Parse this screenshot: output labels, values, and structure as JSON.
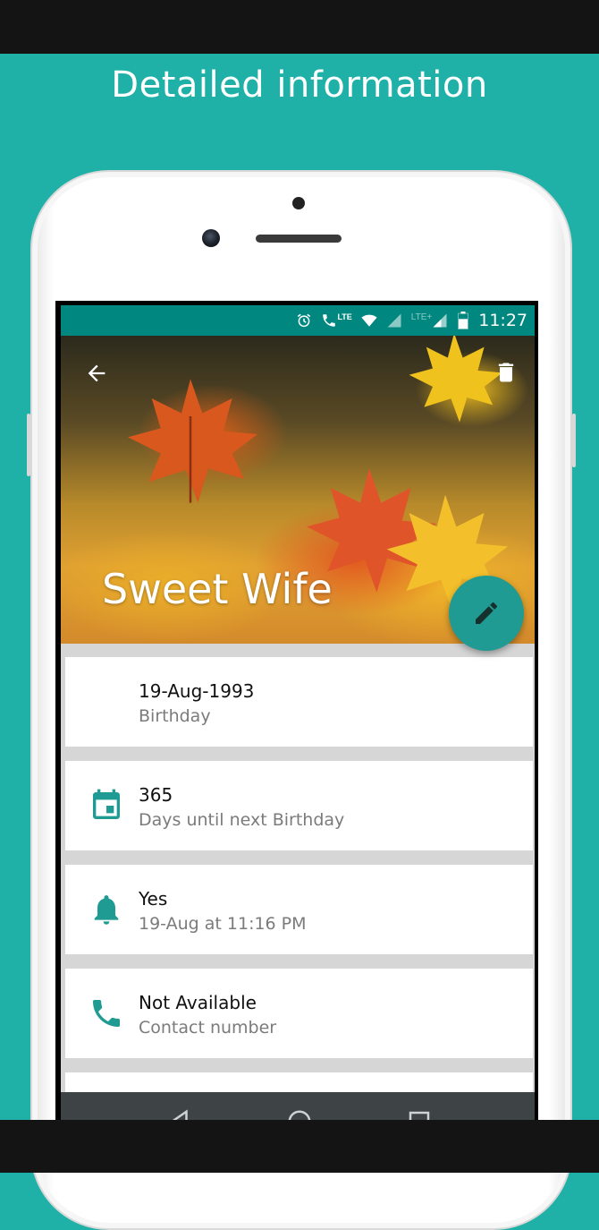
{
  "promo": {
    "title": "Detailed information"
  },
  "status_bar": {
    "time": "11:27",
    "lte_label": "LTE",
    "lte_plus_label": "LTE+"
  },
  "hero": {
    "name": "Sweet Wife"
  },
  "cards": [
    {
      "primary": "19-Aug-1993",
      "secondary": "Birthday",
      "icon": "none"
    },
    {
      "primary": "365",
      "secondary": "Days until next Birthday",
      "icon": "calendar-icon"
    },
    {
      "primary": "Yes",
      "secondary": "19-Aug at 11:16 PM",
      "icon": "bell-icon"
    },
    {
      "primary": "Not Available",
      "secondary": "Contact number",
      "icon": "phone-icon"
    }
  ],
  "colors": {
    "accent": "#1f9b93",
    "status_bar": "#00877f",
    "background": "#1fb1a8"
  }
}
